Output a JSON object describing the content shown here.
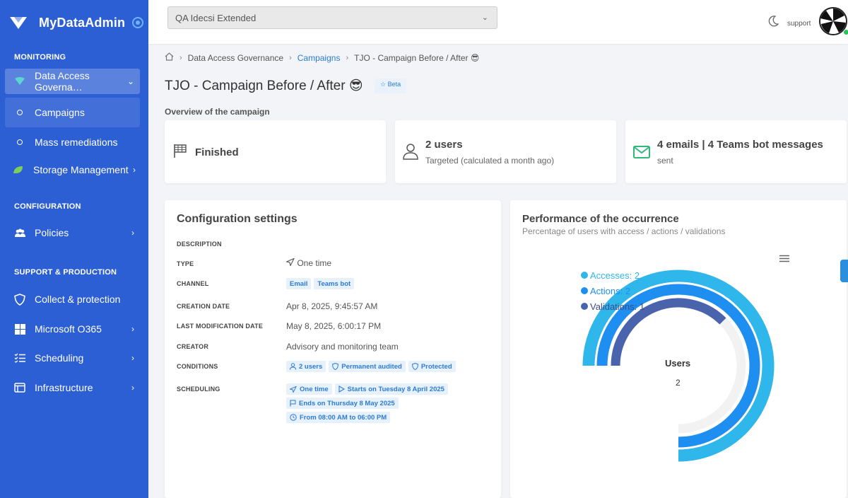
{
  "app": {
    "name": "MyDataAdmin"
  },
  "sidebar": {
    "sections": [
      "MONITORING",
      "CONFIGURATION",
      "SUPPORT & PRODUCTION"
    ],
    "items": [
      {
        "label": "Data Access Governa…",
        "icon": "governance-icon"
      },
      {
        "label": "Campaigns",
        "icon": "circle-bullet"
      },
      {
        "label": "Mass remediations",
        "icon": "circle-bullet"
      },
      {
        "label": "Storage Management",
        "icon": "leaf-icon"
      },
      {
        "label": "Policies",
        "icon": "users-icon"
      },
      {
        "label": "Collect & protection",
        "icon": "shield-icon"
      },
      {
        "label": "Microsoft O365",
        "icon": "windows-icon"
      },
      {
        "label": "Scheduling",
        "icon": "checklist-icon"
      },
      {
        "label": "Infrastructure",
        "icon": "browser-icon"
      }
    ]
  },
  "topbar": {
    "tenant": "QA Idecsi Extended",
    "user": "support"
  },
  "breadcrumb": {
    "items": [
      "Data Access Governance",
      "Campaigns",
      "TJO - Campaign Before / After 😎"
    ]
  },
  "page": {
    "title": "TJO - Campaign Before / After 😎",
    "badge": "Beta",
    "overview_label": "Overview of the campaign"
  },
  "stats": {
    "status": "Finished",
    "users_main": "2 users",
    "users_sub": "Targeted (calculated a month ago)",
    "msg_main": "4 emails | 4 Teams bot messages",
    "msg_sub": "sent"
  },
  "config": {
    "title": "Configuration settings",
    "labels": {
      "description": "DESCRIPTION",
      "type": "TYPE",
      "channel": "CHANNEL",
      "creation": "CREATION DATE",
      "modification": "LAST MODIFICATION DATE",
      "creator": "CREATOR",
      "conditions": "CONDITIONS",
      "scheduling": "SCHEDULING"
    },
    "type": "One time",
    "channels": [
      "Email",
      "Teams bot"
    ],
    "creation_date": "Apr 8, 2025, 9:45:57 AM",
    "modification_date": "May 8, 2025, 6:00:17 PM",
    "creator": "Advisory and monitoring team",
    "conditions": [
      "2 users",
      "Permanent audited",
      "Protected"
    ],
    "scheduling": [
      "One time",
      "Starts on Tuesday 8 April 2025",
      "Ends on Thursday 8 May 2025",
      "From 08:00 AM to 06:00 PM"
    ]
  },
  "performance": {
    "title": "Performance of the occurrence",
    "subtitle": "Percentage of users with access / actions / validations",
    "center_label": "Users",
    "center_value": "2"
  },
  "chart_data": {
    "type": "radialBar",
    "series": [
      {
        "name": "Accesses",
        "value": 2,
        "color": "#2fb6ea"
      },
      {
        "name": "Actions",
        "value": 2,
        "color": "#1f8ef1"
      },
      {
        "name": "Validations",
        "value": 1,
        "color": "#4a63ad"
      }
    ],
    "legend_labels": [
      "Accesses: 2",
      "Actions: 2",
      "Validations: 1"
    ],
    "max": 2
  }
}
